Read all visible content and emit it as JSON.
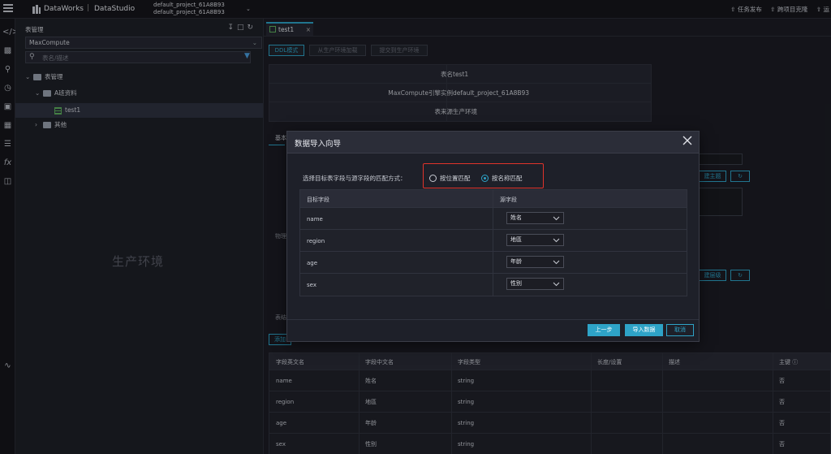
{
  "topbar": {
    "brand": "DataWorks",
    "separator": "|",
    "studio": "DataStudio",
    "project_line1": "default_project_61A8B93",
    "project_line2": "default_project_61A8B93",
    "right_items": [
      "任务发布",
      "跨项目克隆",
      "运"
    ]
  },
  "rail_icons": [
    "code-icon",
    "puzzle-icon",
    "search-icon",
    "clock-icon",
    "briefcase-icon",
    "table-icon",
    "list-icon",
    "function-icon",
    "trash-icon",
    "pulse-icon"
  ],
  "left_panel": {
    "title": "表管理",
    "engine_select": "MaxCompute",
    "search_placeholder": "表名/描述",
    "tree": [
      {
        "label": "表管理"
      },
      {
        "label": "A班资料"
      },
      {
        "label": "test1"
      },
      {
        "label": "其他"
      }
    ],
    "environment_watermark": "生产环境"
  },
  "main": {
    "tab_label": "test1",
    "buttons": {
      "ddl": "DDL模式",
      "load": "从生产环境加载",
      "submit": "提交到生产环境"
    },
    "info": [
      {
        "key": "表名",
        "value": "test1"
      },
      {
        "key": "MaxCompute引擎实例",
        "value": "default_project_61A8B93"
      },
      {
        "key": "表来源",
        "value": "生产环境"
      }
    ],
    "partial_labels": {
      "basic": "基本",
      "physical": "物理",
      "table_struct": "表结",
      "add": "添加",
      "set_theme": "建主题",
      "set_level": "建层级"
    },
    "fields_table": {
      "headers": [
        "字段英文名",
        "字段中文名",
        "字段类型",
        "长度/设置",
        "描述",
        "主键"
      ],
      "rows": [
        [
          "name",
          "姓名",
          "string",
          "",
          "",
          "否"
        ],
        [
          "region",
          "地區",
          "string",
          "",
          "",
          "否"
        ],
        [
          "age",
          "年龄",
          "string",
          "",
          "",
          "否"
        ],
        [
          "sex",
          "性别",
          "string",
          "",
          "",
          "否"
        ]
      ]
    }
  },
  "modal": {
    "title": "数据导入向导",
    "match_label": "选择目标表字段与源字段的匹配方式：",
    "options": {
      "by_position": "按位置匹配",
      "by_name": "按名称匹配"
    },
    "selected_option": "by_name",
    "columns": {
      "target": "目标字段",
      "source": "源字段"
    },
    "rows": [
      {
        "target": "name",
        "source": "姓名"
      },
      {
        "target": "region",
        "source": "地區"
      },
      {
        "target": "age",
        "source": "年龄"
      },
      {
        "target": "sex",
        "source": "性别"
      }
    ],
    "buttons": {
      "prev": "上一步",
      "import": "导入数据",
      "cancel": "取消"
    }
  },
  "colors": {
    "accent": "#2ea3c7",
    "highlight_box": "#e0332a",
    "background": "#1c1d24"
  }
}
